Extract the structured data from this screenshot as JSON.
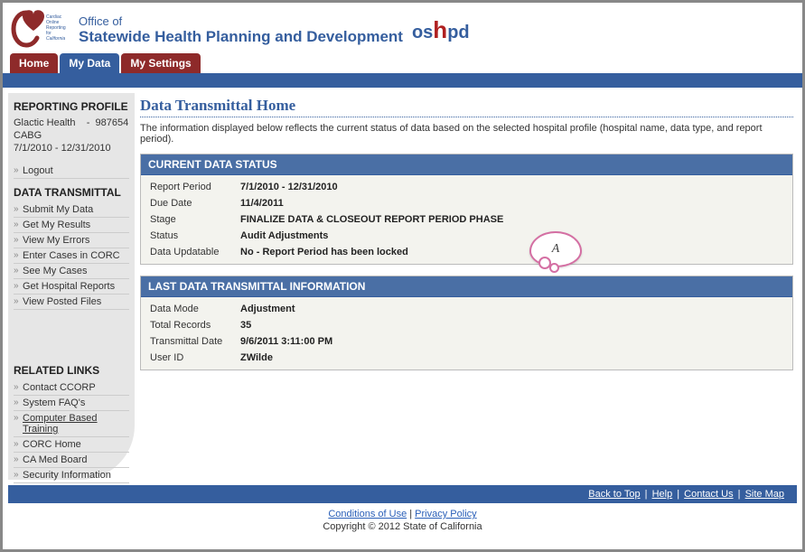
{
  "header": {
    "office_prefix": "Office of",
    "office_name": "Statewide Health Planning and Development",
    "tabs": [
      {
        "label": "Home",
        "active": false
      },
      {
        "label": "My Data",
        "active": true
      },
      {
        "label": "My Settings",
        "active": false
      }
    ]
  },
  "sidebar": {
    "profile_heading": "REPORTING PROFILE",
    "profile_org": "Glactic Health",
    "profile_sep": "-",
    "profile_id": "987654",
    "profile_type": "CABG",
    "profile_period": "7/1/2010 - 12/31/2010",
    "logout": "Logout",
    "transmittal_heading": "DATA TRANSMITTAL",
    "transmittal_items": [
      "Submit My Data",
      "Get My Results",
      "View My Errors",
      "Enter Cases in CORC",
      "See My Cases",
      "Get Hospital Reports",
      "View Posted Files"
    ],
    "related_heading": "RELATED LINKS",
    "related_items": [
      "Contact CCORP",
      "System FAQ's",
      "Computer Based Training",
      "CORC Home",
      "CA Med Board",
      "Security Information"
    ]
  },
  "main": {
    "title": "Data Transmittal Home",
    "intro": "The information displayed below reflects the current status of data based on the selected hospital profile (hospital name, data type, and report period).",
    "status_panel": {
      "header": "CURRENT DATA STATUS",
      "rows": [
        {
          "label": "Report Period",
          "value": "7/1/2010 - 12/31/2010"
        },
        {
          "label": "Due Date",
          "value": "11/4/2011"
        },
        {
          "label": "Stage",
          "value": "FINALIZE DATA & CLOSEOUT REPORT PERIOD PHASE"
        },
        {
          "label": "Status",
          "value": "Audit Adjustments"
        },
        {
          "label": "Data Updatable",
          "value": "No - Report Period has been locked"
        }
      ],
      "callout": "A"
    },
    "last_panel": {
      "header": "LAST DATA TRANSMITTAL INFORMATION",
      "rows": [
        {
          "label": "Data Mode",
          "value": "Adjustment"
        },
        {
          "label": "Total Records",
          "value": "35"
        },
        {
          "label": "Transmittal Date",
          "value": "9/6/2011 3:11:00 PM"
        },
        {
          "label": "User ID",
          "value": "ZWilde"
        }
      ]
    }
  },
  "footer": {
    "blue_links": [
      "Back to Top",
      "Help",
      "Contact Us",
      "Site Map"
    ],
    "bottom_links": [
      "Conditions of Use",
      "Privacy Policy"
    ],
    "sep": " | ",
    "copyright": "Copyright © 2012 State of California"
  }
}
